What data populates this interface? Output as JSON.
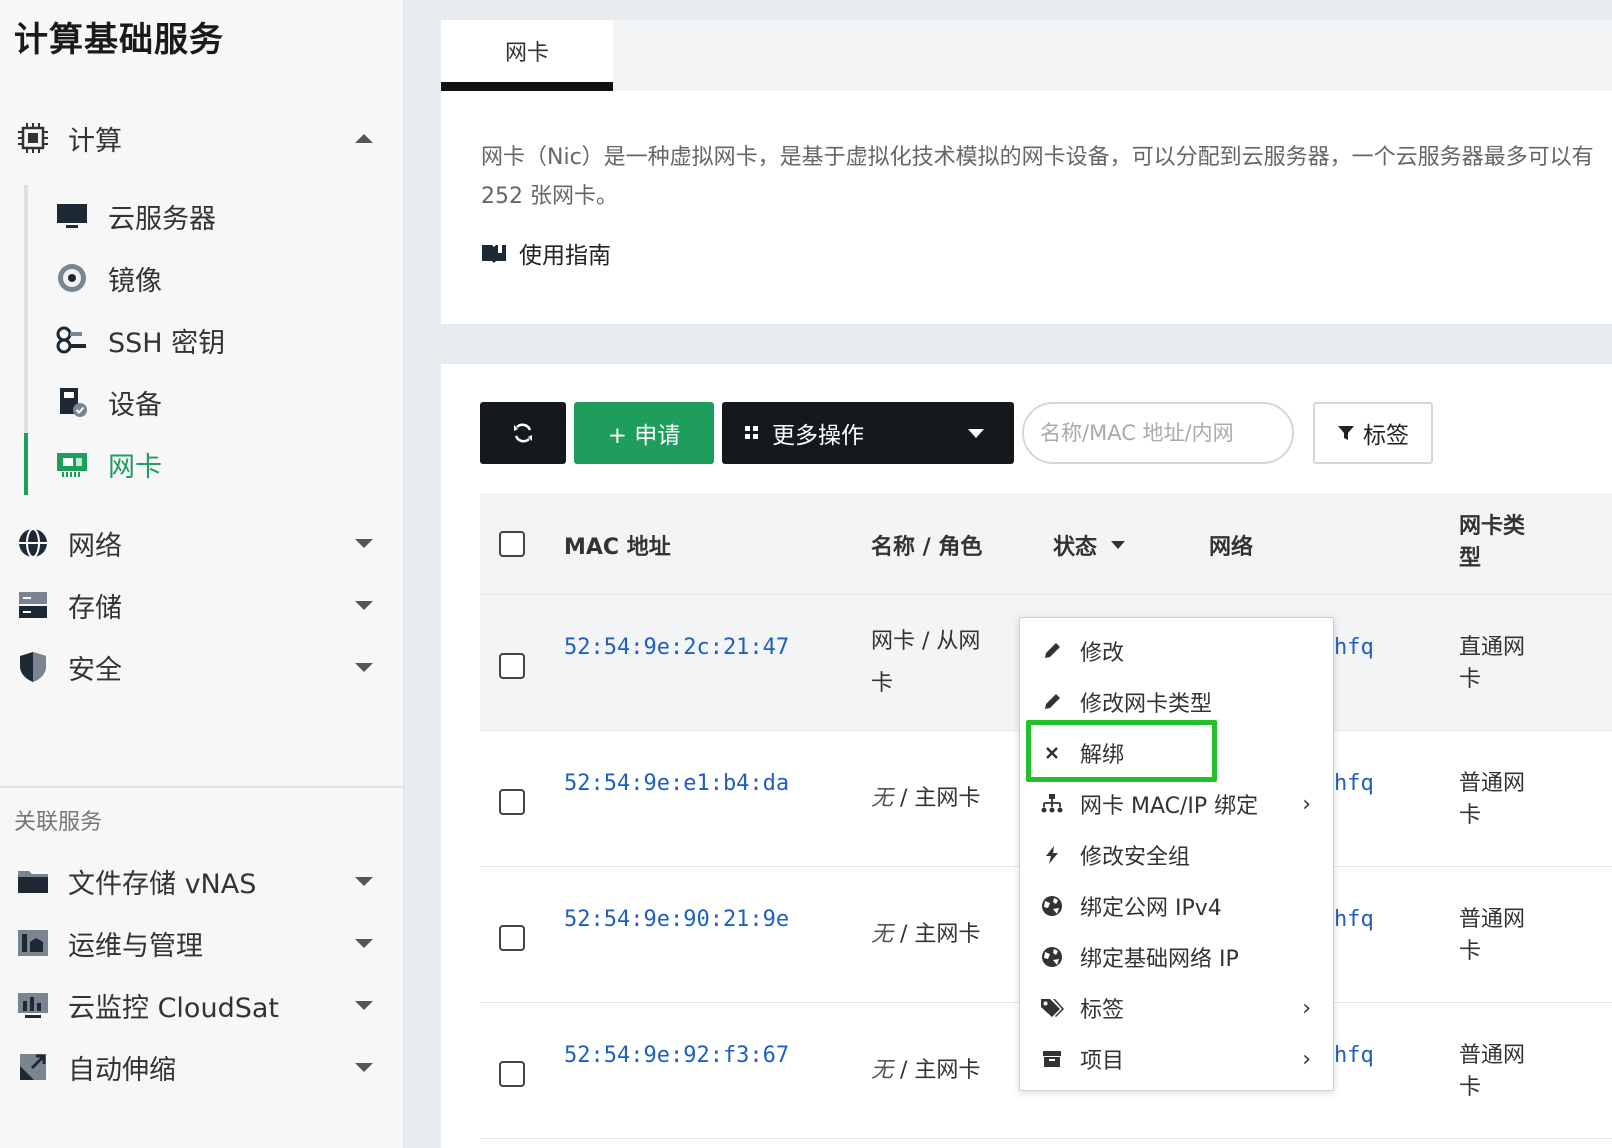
{
  "sidebar": {
    "title": "计算基础服务",
    "compute": {
      "label": "计算"
    },
    "sub_items": [
      {
        "label": "云服务器",
        "icon": "monitor-icon"
      },
      {
        "label": "镜像",
        "icon": "disc-icon"
      },
      {
        "label": "SSH 密钥",
        "icon": "key-icon"
      },
      {
        "label": "设备",
        "icon": "device-icon"
      },
      {
        "label": "网卡",
        "icon": "nic-icon",
        "active": true
      }
    ],
    "groups": [
      {
        "label": "网络",
        "icon": "globe-icon"
      },
      {
        "label": "存储",
        "icon": "storage-icon"
      },
      {
        "label": "安全",
        "icon": "shield-icon"
      }
    ],
    "related_label": "关联服务",
    "related": [
      {
        "label": "文件存储 vNAS",
        "icon": "folder-icon"
      },
      {
        "label": "运维与管理",
        "icon": "ops-icon"
      },
      {
        "label": "云监控 CloudSat",
        "icon": "chart-icon"
      },
      {
        "label": "自动伸缩",
        "icon": "scale-icon"
      }
    ]
  },
  "tabs": {
    "active": "网卡"
  },
  "intro": {
    "description": "网卡（Nic）是一种虚拟网卡，是基于虚拟化技术模拟的网卡设备，可以分配到云服务器，一个云服务器最多可以有 252 张网卡。",
    "guide": "使用指南"
  },
  "toolbar": {
    "apply": "+ 申请",
    "more": "更多操作",
    "search_placeholder": "名称/MAC 地址/内网",
    "tag": "标签"
  },
  "table": {
    "headers": {
      "mac": "MAC 地址",
      "name_role": "名称 / 角色",
      "status": "状态",
      "network": "网络",
      "nic_type": "网卡类型"
    },
    "rows": [
      {
        "mac": "52:54:9e:2c:21:47",
        "role_name": "网卡",
        "role": "从网卡",
        "network": "hfq",
        "type": "直通网卡"
      },
      {
        "mac": "52:54:9e:e1:b4:da",
        "role_name": "无",
        "role": "主网卡",
        "network": "hfq",
        "type": "普通网卡"
      },
      {
        "mac": "52:54:9e:90:21:9e",
        "role_name": "无",
        "role": "主网卡",
        "network": "hfq",
        "type": "普通网卡"
      },
      {
        "mac": "52:54:9e:92:f3:67",
        "role_name": "无",
        "role": "主网卡",
        "network": "hfq",
        "type": "普通网卡"
      }
    ]
  },
  "menu": {
    "items": [
      {
        "label": "修改",
        "icon": "pencil-icon"
      },
      {
        "label": "修改网卡类型",
        "icon": "pencil-icon"
      },
      {
        "label": "解绑",
        "icon": "close-icon"
      },
      {
        "label": "网卡 MAC/IP 绑定",
        "icon": "sitemap-icon",
        "submenu": true
      },
      {
        "label": "修改安全组",
        "icon": "bolt-icon"
      },
      {
        "label": "绑定公网 IPv4",
        "icon": "globe-icon"
      },
      {
        "label": "绑定基础网络 IP",
        "icon": "globe-icon"
      },
      {
        "label": "标签",
        "icon": "tags-icon",
        "submenu": true
      },
      {
        "label": "项目",
        "icon": "archive-icon",
        "submenu": true
      }
    ]
  },
  "colors": {
    "accent": "#1f9d5c",
    "dark_button": "#15191c",
    "link": "#1f5fbf",
    "highlight": "#22c02a"
  }
}
